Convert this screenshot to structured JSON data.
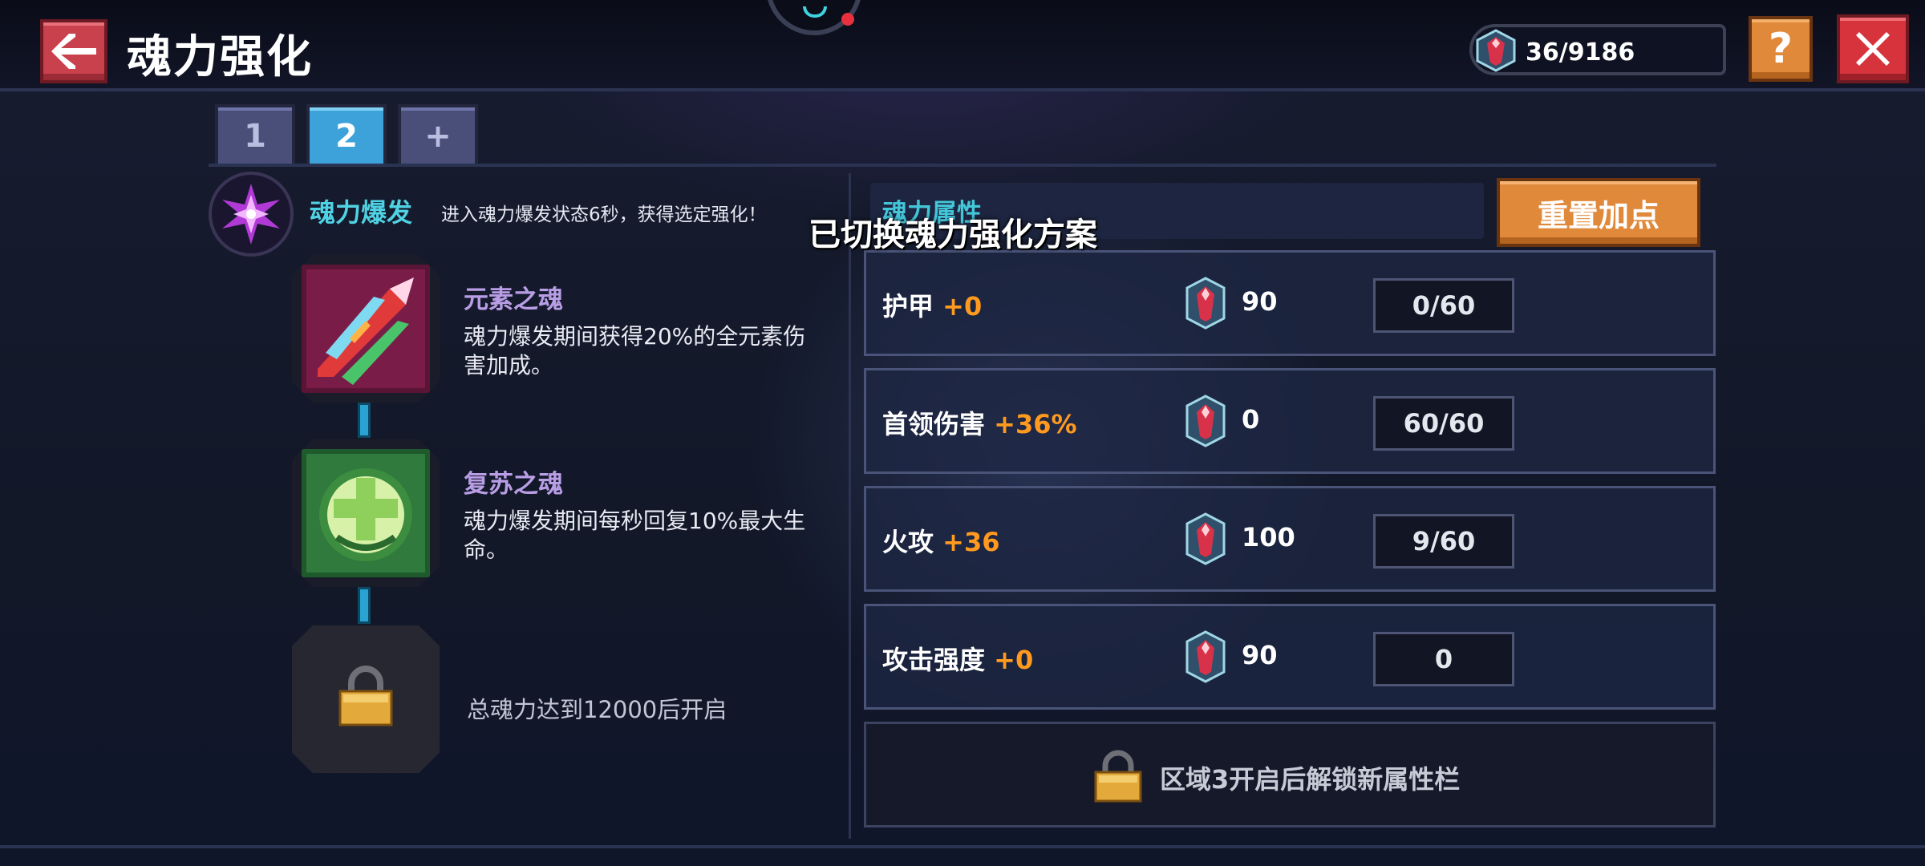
{
  "header": {
    "title": "魂力强化",
    "currency": "36/9186"
  },
  "tabs": [
    {
      "label": "1",
      "active": false
    },
    {
      "label": "2",
      "active": true
    },
    {
      "label": "+",
      "active": false
    }
  ],
  "soul_burst": {
    "title": "魂力爆发",
    "description": "进入魂力爆发状态6秒，获得选定强化！"
  },
  "skills": [
    {
      "name": "元素之魂",
      "description": "魂力爆发期间获得20%的全元素伤害加成。"
    },
    {
      "name": "复苏之魂",
      "description": "魂力爆发期间每秒回复10%最大生命。"
    }
  ],
  "locked_skill_text": "总魂力达到12000后开启",
  "attributes": {
    "header_label": "魂力属性",
    "reset_button": "重置加点",
    "rows": [
      {
        "name": "护甲",
        "bonus": "+0",
        "cost": "90",
        "level": "0/60"
      },
      {
        "name": "首领伤害",
        "bonus": "+36%",
        "cost": "0",
        "level": "60/60"
      },
      {
        "name": "火攻",
        "bonus": "+36",
        "cost": "100",
        "level": "9/60"
      },
      {
        "name": "攻击强度",
        "bonus": "+0",
        "cost": "90",
        "level": "0"
      }
    ],
    "locked_row_text": "区域3开启后解锁新属性栏"
  },
  "toast": "已切换魂力强化方案",
  "icons": {
    "back": "arrow-left-icon",
    "help": "question-icon",
    "close": "close-icon",
    "gem": "soul-gem-icon",
    "lock": "lock-icon",
    "burst": "soul-burst-icon"
  },
  "colors": {
    "accent_cyan": "#4fd2e3",
    "bonus_orange": "#ff9a1f",
    "button_orange": "#e0893a",
    "button_red": "#d7333d",
    "tab_active": "#3ea2da",
    "skill_name_purple": "#b99ee6"
  }
}
